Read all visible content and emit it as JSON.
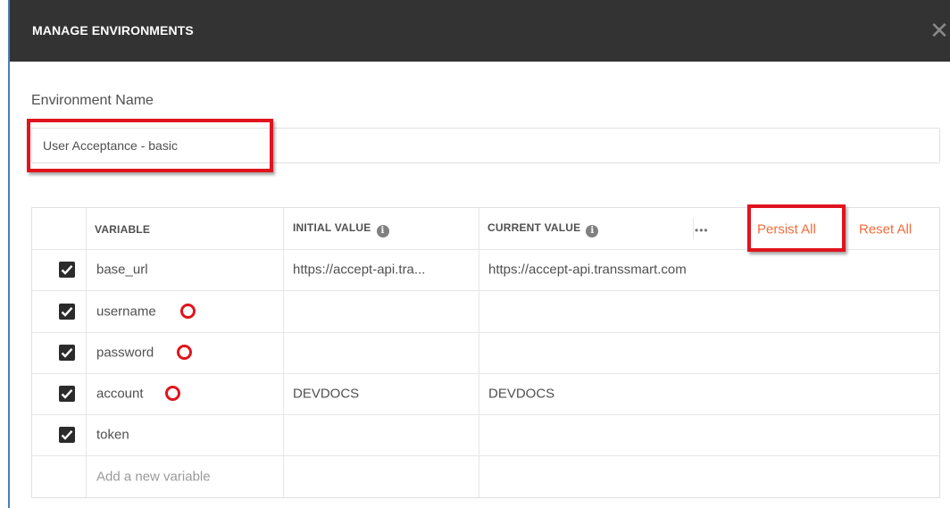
{
  "header": {
    "title": "MANAGE ENVIRONMENTS",
    "close_glyph": "✕"
  },
  "environment": {
    "label": "Environment Name",
    "name_value": "User Acceptance - basic"
  },
  "table": {
    "columns": {
      "variable": "VARIABLE",
      "initial_value": "INITIAL VALUE",
      "current_value": "CURRENT VALUE"
    },
    "info_glyph": "i",
    "more_glyph": "•••",
    "persist_all_label": "Persist All",
    "reset_all_label": "Reset All",
    "rows": [
      {
        "enabled": true,
        "variable": "base_url",
        "initial": "https://accept-api.tra...",
        "current": "https://accept-api.transsmart.com"
      },
      {
        "enabled": true,
        "variable": "username",
        "initial": "",
        "current": ""
      },
      {
        "enabled": true,
        "variable": "password",
        "initial": "",
        "current": ""
      },
      {
        "enabled": true,
        "variable": "account",
        "initial": "DEVDOCS",
        "current": "DEVDOCS"
      },
      {
        "enabled": true,
        "variable": "token",
        "initial": "",
        "current": ""
      }
    ],
    "new_variable_placeholder": "Add a new variable"
  },
  "colors": {
    "header_bg": "#333333",
    "accent_link": "#f26b3a",
    "annotation_red": "#e0141e",
    "checkbox": "#2b2b2b"
  }
}
